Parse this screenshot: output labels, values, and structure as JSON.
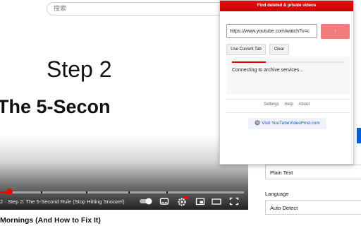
{
  "youtube": {
    "search_placeholder": "搜索",
    "video": {
      "step_title": "Step 2",
      "rule_title": "The 5-Secon",
      "chapter_text": "2 · Step 2: The 5-Second Rule (Stop Hitting Snooze!)",
      "progress_percent": 4
    },
    "video_title": "Mornings (And How to Fix It)",
    "side_panel": {
      "format_value": "Plain Text",
      "language_label": "Language",
      "language_value": "Auto Detect"
    }
  },
  "popup": {
    "header": "Find deleted & private videos",
    "url_value": "https://www.youtube.com/watch?v=c",
    "go_label": "↑",
    "use_current_tab": "Use Current Tab",
    "clear": "Clear",
    "status_text": "Connecting to archive services...",
    "status_progress_percent": 30,
    "links": {
      "settings": "Settings",
      "help": "Help",
      "about": "About"
    },
    "visit_label": "🔘 Visit YouTubeVideoFind.com"
  },
  "colors": {
    "accent": "#cc0000",
    "go_button": "#f47b7b",
    "link": "#1a55b8",
    "youtube_red": "#ff0000"
  }
}
